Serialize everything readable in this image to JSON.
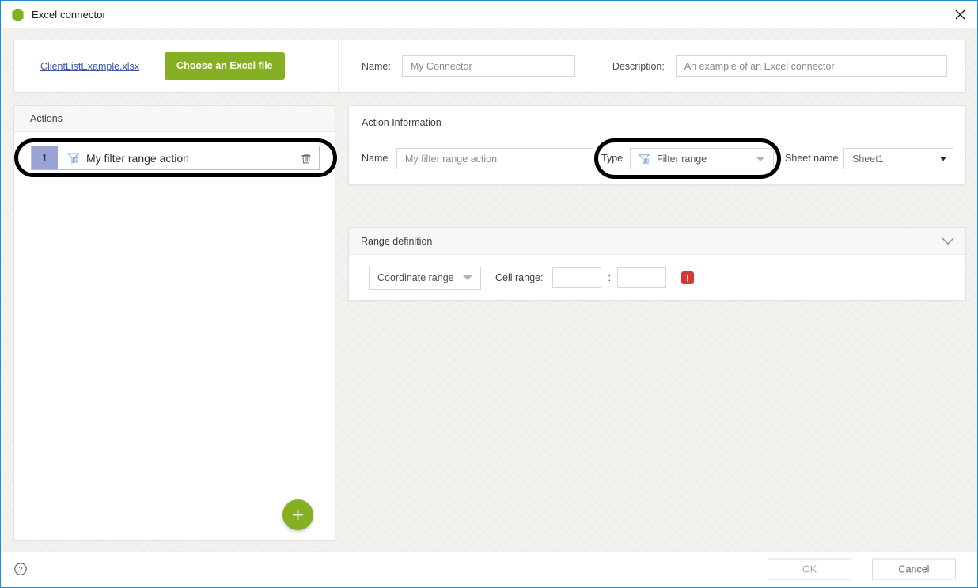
{
  "window": {
    "title": "Excel connector",
    "app_icon": "excel-connector-hexagon-icon",
    "close_icon": "close-icon",
    "accent_color": "#1c8ad4"
  },
  "top_bar": {
    "file_link": "ClientListExample.xlsx",
    "choose_file_button": "Choose an Excel file",
    "choose_file_color": "#86b023",
    "name_label": "Name:",
    "name_value": "My Connector",
    "description_label": "Description:",
    "description_value": "An example of an Excel connector"
  },
  "actions_panel": {
    "header": "Actions",
    "add_icon": "plus-icon",
    "items": [
      {
        "index": "1",
        "label": "My filter range action",
        "type_icon": "filter-range-icon",
        "delete_icon": "trash-icon",
        "index_badge_color": "#9aa4d4",
        "selected": true,
        "annotated": true
      }
    ]
  },
  "action_information": {
    "title": "Action Information",
    "name_label": "Name",
    "name_value": "My filter range action",
    "type_label": "Type",
    "type_value": "Filter range",
    "type_icon": "filter-range-icon",
    "type_arrow_icon": "chevron-down-icon",
    "type_annotated": true,
    "sheet_label": "Sheet name",
    "sheet_value": "Sheet1",
    "sheet_arrow_icon": "chevron-down-icon"
  },
  "range_definition": {
    "title": "Range definition",
    "collapse_icon": "chevron-down-icon",
    "mode_value": "Coordinate range",
    "mode_arrow_icon": "chevron-down-icon",
    "cell_range_label": "Cell range:",
    "cell_start_value": "",
    "cell_end_value": "",
    "separator": ":",
    "error_icon": "error-exclamation-icon",
    "error_color": "#d23b34"
  },
  "footer": {
    "help_icon": "help-question-icon",
    "ok_label": "OK",
    "cancel_label": "Cancel"
  }
}
